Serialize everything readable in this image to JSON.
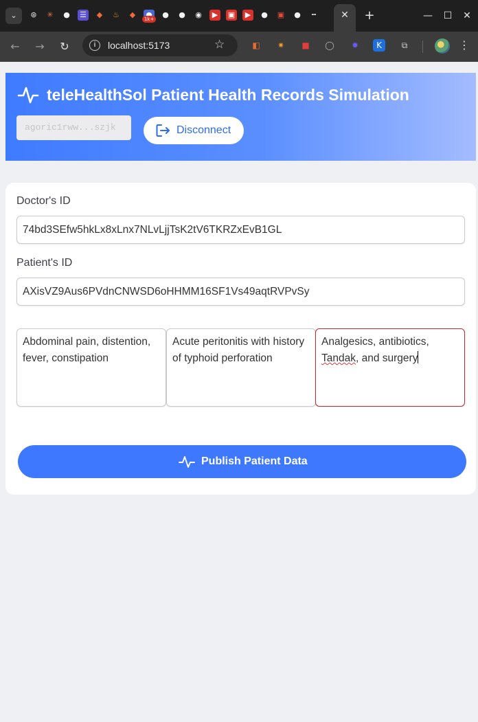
{
  "browser": {
    "url": "localhost:5173",
    "tab_favicons": [
      "openai-icon",
      "claude-icon",
      "github-icon",
      "list-icon",
      "figma-icon",
      "flame-icon",
      "figma-icon",
      "badge-icon",
      "github-icon",
      "github-icon",
      "circle-icon",
      "youtube-icon",
      "youtube-icon",
      "youtube-icon",
      "github-icon",
      "box-icon",
      "github-icon",
      "dash-icon"
    ],
    "favicon_badge": "1k+",
    "extensions": [
      "bookmark-ext-icon",
      "spark-ext-icon",
      "lock-ext-icon",
      "ring-ext-icon",
      "gear-ext-icon",
      "k-ext-icon",
      "puzzle-icon"
    ],
    "k_ext_letter": "K"
  },
  "app": {
    "title": "teleHealthSol Patient Health Records Simulation",
    "wallet_address": "agoric1rww...szjk",
    "disconnect_label": "Disconnect",
    "accent_color": "#3d78ff"
  },
  "form": {
    "doctor_label": "Doctor's ID",
    "doctor_id": "74bd3SEfw5hkLx8xLnx7NLvLjjTsK2tV6TKRZxEvB1GL",
    "patient_label": "Patient's ID",
    "patient_id": "AXisVZ9Aus6PVdnCNWSD6oHHMM16SF1Vs49aqtRVPvSy",
    "symptoms": "Abdominal pain, distention, fever, constipation",
    "diagnosis": "Acute peritonitis with history of typhoid perforation",
    "treatment_part1": "Analgesics, antibiotics, ",
    "treatment_misspelled": "Tandak",
    "treatment_part2": ", and surgery",
    "publish_label": "Publish Patient Data"
  }
}
